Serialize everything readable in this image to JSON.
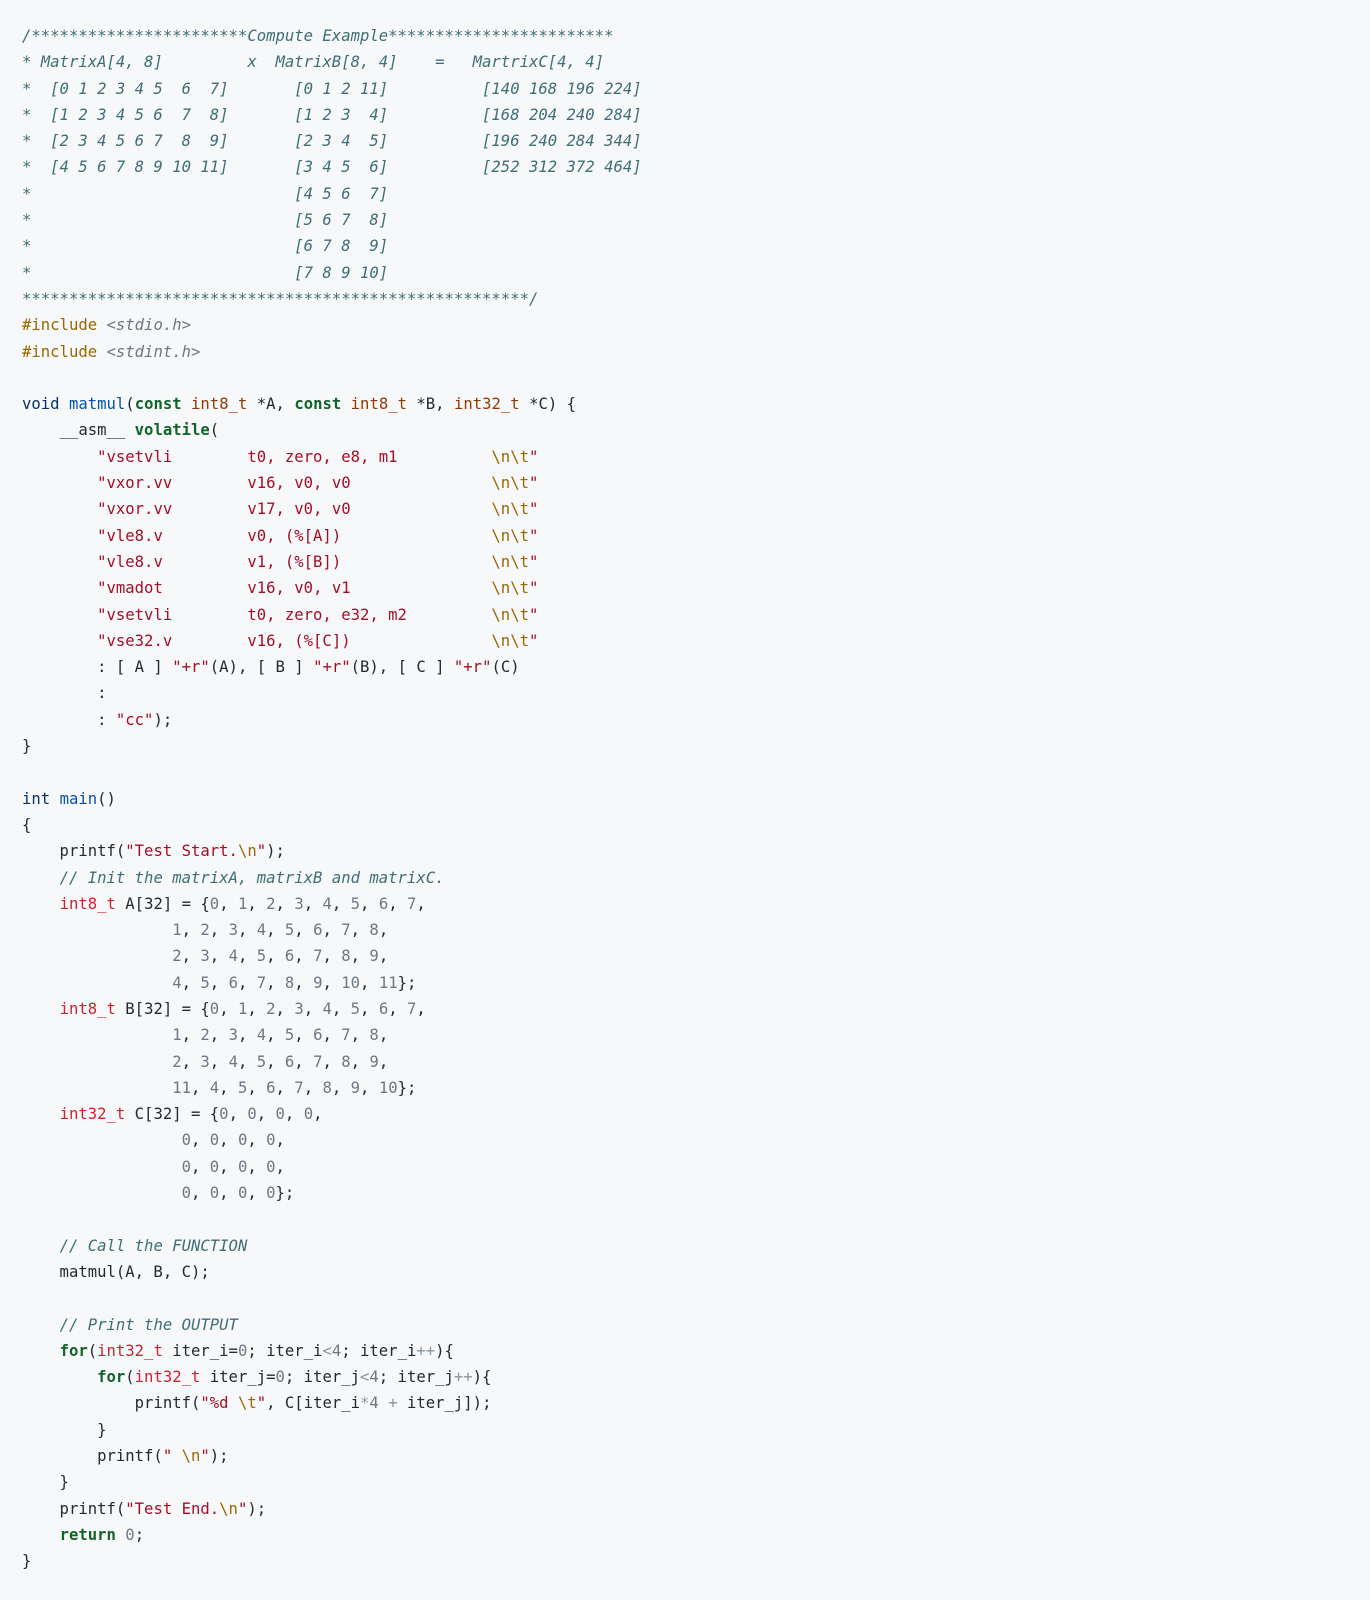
{
  "language": "c",
  "token_colors": {
    "cm": "#3f6e74",
    "pp": "#9a6700",
    "hdr": "#6e7781",
    "kw": "#0a3069",
    "kwb": "#116329",
    "ty": "#953800",
    "fn": "#8250df",
    "fnb": "#0550ae",
    "st": "#a40e26",
    "esc": "#9a6700",
    "nm": "#6e7781",
    "op": "#8c959f",
    "id": "#24292f",
    "vd": "#0a3069",
    "it": "#cf222e"
  },
  "lines": [
    [
      [
        "cm",
        "/***********************Compute Example************************"
      ]
    ],
    [
      [
        "cm",
        "* MatrixA[4, 8]         x  MatrixB[8, 4]    =   MartrixC[4, 4]"
      ]
    ],
    [
      [
        "cm",
        "*  [0 1 2 3 4 5  6  7]       [0 1 2 11]          [140 168 196 224]"
      ]
    ],
    [
      [
        "cm",
        "*  [1 2 3 4 5 6  7  8]       [1 2 3  4]          [168 204 240 284]"
      ]
    ],
    [
      [
        "cm",
        "*  [2 3 4 5 6 7  8  9]       [2 3 4  5]          [196 240 284 344]"
      ]
    ],
    [
      [
        "cm",
        "*  [4 5 6 7 8 9 10 11]       [3 4 5  6]          [252 312 372 464]"
      ]
    ],
    [
      [
        "cm",
        "*                            [4 5 6  7]"
      ]
    ],
    [
      [
        "cm",
        "*                            [5 6 7  8]"
      ]
    ],
    [
      [
        "cm",
        "*                            [6 7 8  9]"
      ]
    ],
    [
      [
        "cm",
        "*                            [7 8 9 10]"
      ]
    ],
    [
      [
        "cm",
        "******************************************************/"
      ]
    ],
    [
      [
        "pp",
        "#include"
      ],
      [
        "id",
        " "
      ],
      [
        "hdr",
        "<stdio.h>"
      ]
    ],
    [
      [
        "pp",
        "#include"
      ],
      [
        "id",
        " "
      ],
      [
        "hdr",
        "<stdint.h>"
      ]
    ],
    [],
    [
      [
        "vd",
        "void"
      ],
      [
        "id",
        " "
      ],
      [
        "fnb",
        "matmul"
      ],
      [
        "id",
        "("
      ],
      [
        "kwb",
        "const"
      ],
      [
        "id",
        " "
      ],
      [
        "ty",
        "int8_t"
      ],
      [
        "id",
        " *A, "
      ],
      [
        "kwb",
        "const"
      ],
      [
        "id",
        " "
      ],
      [
        "ty",
        "int8_t"
      ],
      [
        "id",
        " *B, "
      ],
      [
        "ty",
        "int32_t"
      ],
      [
        "id",
        " *C) {"
      ]
    ],
    [
      [
        "id",
        "    __asm__ "
      ],
      [
        "kwb",
        "volatile"
      ],
      [
        "id",
        "("
      ]
    ],
    [
      [
        "id",
        "        "
      ],
      [
        "st",
        "\"vsetvli        t0, zero, e8, m1          "
      ],
      [
        "esc",
        "\\n\\t"
      ],
      [
        "st",
        "\""
      ]
    ],
    [
      [
        "id",
        "        "
      ],
      [
        "st",
        "\"vxor.vv        v16, v0, v0               "
      ],
      [
        "esc",
        "\\n\\t"
      ],
      [
        "st",
        "\""
      ]
    ],
    [
      [
        "id",
        "        "
      ],
      [
        "st",
        "\"vxor.vv        v17, v0, v0               "
      ],
      [
        "esc",
        "\\n\\t"
      ],
      [
        "st",
        "\""
      ]
    ],
    [
      [
        "id",
        "        "
      ],
      [
        "st",
        "\"vle8.v         v0, (%[A])                "
      ],
      [
        "esc",
        "\\n\\t"
      ],
      [
        "st",
        "\""
      ]
    ],
    [
      [
        "id",
        "        "
      ],
      [
        "st",
        "\"vle8.v         v1, (%[B])                "
      ],
      [
        "esc",
        "\\n\\t"
      ],
      [
        "st",
        "\""
      ]
    ],
    [
      [
        "id",
        "        "
      ],
      [
        "st",
        "\"vmadot         v16, v0, v1               "
      ],
      [
        "esc",
        "\\n\\t"
      ],
      [
        "st",
        "\""
      ]
    ],
    [
      [
        "id",
        "        "
      ],
      [
        "st",
        "\"vsetvli        t0, zero, e32, m2         "
      ],
      [
        "esc",
        "\\n\\t"
      ],
      [
        "st",
        "\""
      ]
    ],
    [
      [
        "id",
        "        "
      ],
      [
        "st",
        "\"vse32.v        v16, (%[C])               "
      ],
      [
        "esc",
        "\\n\\t"
      ],
      [
        "st",
        "\""
      ]
    ],
    [
      [
        "id",
        "        : [ A ] "
      ],
      [
        "st",
        "\"+r\""
      ],
      [
        "id",
        "(A), [ B ] "
      ],
      [
        "st",
        "\"+r\""
      ],
      [
        "id",
        "(B), [ C ] "
      ],
      [
        "st",
        "\"+r\""
      ],
      [
        "id",
        "(C)"
      ]
    ],
    [
      [
        "id",
        "        :"
      ]
    ],
    [
      [
        "id",
        "        : "
      ],
      [
        "st",
        "\"cc\""
      ],
      [
        "id",
        ");"
      ]
    ],
    [
      [
        "id",
        "}"
      ]
    ],
    [],
    [
      [
        "vd",
        "int"
      ],
      [
        "id",
        " "
      ],
      [
        "fnb",
        "main"
      ],
      [
        "id",
        "()"
      ]
    ],
    [
      [
        "id",
        "{"
      ]
    ],
    [
      [
        "id",
        "    printf("
      ],
      [
        "st",
        "\"Test Start."
      ],
      [
        "esc",
        "\\n"
      ],
      [
        "st",
        "\""
      ],
      [
        "id",
        ");"
      ]
    ],
    [
      [
        "id",
        "    "
      ],
      [
        "cm",
        "// Init the matrixA, matrixB and matrixC."
      ]
    ],
    [
      [
        "id",
        "    "
      ],
      [
        "it",
        "int8_t"
      ],
      [
        "id",
        " A[32] = {"
      ],
      [
        "nm",
        "0"
      ],
      [
        "id",
        ", "
      ],
      [
        "nm",
        "1"
      ],
      [
        "id",
        ", "
      ],
      [
        "nm",
        "2"
      ],
      [
        "id",
        ", "
      ],
      [
        "nm",
        "3"
      ],
      [
        "id",
        ", "
      ],
      [
        "nm",
        "4"
      ],
      [
        "id",
        ", "
      ],
      [
        "nm",
        "5"
      ],
      [
        "id",
        ", "
      ],
      [
        "nm",
        "6"
      ],
      [
        "id",
        ", "
      ],
      [
        "nm",
        "7"
      ],
      [
        "id",
        ","
      ]
    ],
    [
      [
        "id",
        "                "
      ],
      [
        "nm",
        "1"
      ],
      [
        "id",
        ", "
      ],
      [
        "nm",
        "2"
      ],
      [
        "id",
        ", "
      ],
      [
        "nm",
        "3"
      ],
      [
        "id",
        ", "
      ],
      [
        "nm",
        "4"
      ],
      [
        "id",
        ", "
      ],
      [
        "nm",
        "5"
      ],
      [
        "id",
        ", "
      ],
      [
        "nm",
        "6"
      ],
      [
        "id",
        ", "
      ],
      [
        "nm",
        "7"
      ],
      [
        "id",
        ", "
      ],
      [
        "nm",
        "8"
      ],
      [
        "id",
        ","
      ]
    ],
    [
      [
        "id",
        "                "
      ],
      [
        "nm",
        "2"
      ],
      [
        "id",
        ", "
      ],
      [
        "nm",
        "3"
      ],
      [
        "id",
        ", "
      ],
      [
        "nm",
        "4"
      ],
      [
        "id",
        ", "
      ],
      [
        "nm",
        "5"
      ],
      [
        "id",
        ", "
      ],
      [
        "nm",
        "6"
      ],
      [
        "id",
        ", "
      ],
      [
        "nm",
        "7"
      ],
      [
        "id",
        ", "
      ],
      [
        "nm",
        "8"
      ],
      [
        "id",
        ", "
      ],
      [
        "nm",
        "9"
      ],
      [
        "id",
        ","
      ]
    ],
    [
      [
        "id",
        "                "
      ],
      [
        "nm",
        "4"
      ],
      [
        "id",
        ", "
      ],
      [
        "nm",
        "5"
      ],
      [
        "id",
        ", "
      ],
      [
        "nm",
        "6"
      ],
      [
        "id",
        ", "
      ],
      [
        "nm",
        "7"
      ],
      [
        "id",
        ", "
      ],
      [
        "nm",
        "8"
      ],
      [
        "id",
        ", "
      ],
      [
        "nm",
        "9"
      ],
      [
        "id",
        ", "
      ],
      [
        "nm",
        "10"
      ],
      [
        "id",
        ", "
      ],
      [
        "nm",
        "11"
      ],
      [
        "id",
        "};"
      ]
    ],
    [
      [
        "id",
        "    "
      ],
      [
        "it",
        "int8_t"
      ],
      [
        "id",
        " B[32] = {"
      ],
      [
        "nm",
        "0"
      ],
      [
        "id",
        ", "
      ],
      [
        "nm",
        "1"
      ],
      [
        "id",
        ", "
      ],
      [
        "nm",
        "2"
      ],
      [
        "id",
        ", "
      ],
      [
        "nm",
        "3"
      ],
      [
        "id",
        ", "
      ],
      [
        "nm",
        "4"
      ],
      [
        "id",
        ", "
      ],
      [
        "nm",
        "5"
      ],
      [
        "id",
        ", "
      ],
      [
        "nm",
        "6"
      ],
      [
        "id",
        ", "
      ],
      [
        "nm",
        "7"
      ],
      [
        "id",
        ","
      ]
    ],
    [
      [
        "id",
        "                "
      ],
      [
        "nm",
        "1"
      ],
      [
        "id",
        ", "
      ],
      [
        "nm",
        "2"
      ],
      [
        "id",
        ", "
      ],
      [
        "nm",
        "3"
      ],
      [
        "id",
        ", "
      ],
      [
        "nm",
        "4"
      ],
      [
        "id",
        ", "
      ],
      [
        "nm",
        "5"
      ],
      [
        "id",
        ", "
      ],
      [
        "nm",
        "6"
      ],
      [
        "id",
        ", "
      ],
      [
        "nm",
        "7"
      ],
      [
        "id",
        ", "
      ],
      [
        "nm",
        "8"
      ],
      [
        "id",
        ","
      ]
    ],
    [
      [
        "id",
        "                "
      ],
      [
        "nm",
        "2"
      ],
      [
        "id",
        ", "
      ],
      [
        "nm",
        "3"
      ],
      [
        "id",
        ", "
      ],
      [
        "nm",
        "4"
      ],
      [
        "id",
        ", "
      ],
      [
        "nm",
        "5"
      ],
      [
        "id",
        ", "
      ],
      [
        "nm",
        "6"
      ],
      [
        "id",
        ", "
      ],
      [
        "nm",
        "7"
      ],
      [
        "id",
        ", "
      ],
      [
        "nm",
        "8"
      ],
      [
        "id",
        ", "
      ],
      [
        "nm",
        "9"
      ],
      [
        "id",
        ","
      ]
    ],
    [
      [
        "id",
        "                "
      ],
      [
        "nm",
        "11"
      ],
      [
        "id",
        ", "
      ],
      [
        "nm",
        "4"
      ],
      [
        "id",
        ", "
      ],
      [
        "nm",
        "5"
      ],
      [
        "id",
        ", "
      ],
      [
        "nm",
        "6"
      ],
      [
        "id",
        ", "
      ],
      [
        "nm",
        "7"
      ],
      [
        "id",
        ", "
      ],
      [
        "nm",
        "8"
      ],
      [
        "id",
        ", "
      ],
      [
        "nm",
        "9"
      ],
      [
        "id",
        ", "
      ],
      [
        "nm",
        "10"
      ],
      [
        "id",
        "};"
      ]
    ],
    [
      [
        "id",
        "    "
      ],
      [
        "it",
        "int32_t"
      ],
      [
        "id",
        " C[32] = {"
      ],
      [
        "nm",
        "0"
      ],
      [
        "id",
        ", "
      ],
      [
        "nm",
        "0"
      ],
      [
        "id",
        ", "
      ],
      [
        "nm",
        "0"
      ],
      [
        "id",
        ", "
      ],
      [
        "nm",
        "0"
      ],
      [
        "id",
        ","
      ]
    ],
    [
      [
        "id",
        "                 "
      ],
      [
        "nm",
        "0"
      ],
      [
        "id",
        ", "
      ],
      [
        "nm",
        "0"
      ],
      [
        "id",
        ", "
      ],
      [
        "nm",
        "0"
      ],
      [
        "id",
        ", "
      ],
      [
        "nm",
        "0"
      ],
      [
        "id",
        ","
      ]
    ],
    [
      [
        "id",
        "                 "
      ],
      [
        "nm",
        "0"
      ],
      [
        "id",
        ", "
      ],
      [
        "nm",
        "0"
      ],
      [
        "id",
        ", "
      ],
      [
        "nm",
        "0"
      ],
      [
        "id",
        ", "
      ],
      [
        "nm",
        "0"
      ],
      [
        "id",
        ","
      ]
    ],
    [
      [
        "id",
        "                 "
      ],
      [
        "nm",
        "0"
      ],
      [
        "id",
        ", "
      ],
      [
        "nm",
        "0"
      ],
      [
        "id",
        ", "
      ],
      [
        "nm",
        "0"
      ],
      [
        "id",
        ", "
      ],
      [
        "nm",
        "0"
      ],
      [
        "id",
        "};"
      ]
    ],
    [],
    [
      [
        "id",
        "    "
      ],
      [
        "cm",
        "// Call the FUNCTION"
      ]
    ],
    [
      [
        "id",
        "    matmul(A, B, C);"
      ]
    ],
    [],
    [
      [
        "id",
        "    "
      ],
      [
        "cm",
        "// Print the OUTPUT"
      ]
    ],
    [
      [
        "id",
        "    "
      ],
      [
        "kwb",
        "for"
      ],
      [
        "id",
        "("
      ],
      [
        "it",
        "int32_t"
      ],
      [
        "id",
        " iter_i="
      ],
      [
        "nm",
        "0"
      ],
      [
        "id",
        "; iter_i"
      ],
      [
        "op",
        "<"
      ],
      [
        "nm",
        "4"
      ],
      [
        "id",
        "; iter_i"
      ],
      [
        "op",
        "++"
      ],
      [
        "id",
        "){"
      ]
    ],
    [
      [
        "id",
        "        "
      ],
      [
        "kwb",
        "for"
      ],
      [
        "id",
        "("
      ],
      [
        "it",
        "int32_t"
      ],
      [
        "id",
        " iter_j="
      ],
      [
        "nm",
        "0"
      ],
      [
        "id",
        "; iter_j"
      ],
      [
        "op",
        "<"
      ],
      [
        "nm",
        "4"
      ],
      [
        "id",
        "; iter_j"
      ],
      [
        "op",
        "++"
      ],
      [
        "id",
        "){"
      ]
    ],
    [
      [
        "id",
        "            printf("
      ],
      [
        "st",
        "\"%d "
      ],
      [
        "esc",
        "\\t"
      ],
      [
        "st",
        "\""
      ],
      [
        "id",
        ", C[iter_i"
      ],
      [
        "op",
        "*"
      ],
      [
        "nm",
        "4"
      ],
      [
        "id",
        " "
      ],
      [
        "op",
        "+"
      ],
      [
        "id",
        " iter_j]);"
      ]
    ],
    [
      [
        "id",
        "        }"
      ]
    ],
    [
      [
        "id",
        "        printf("
      ],
      [
        "st",
        "\" "
      ],
      [
        "esc",
        "\\n"
      ],
      [
        "st",
        "\""
      ],
      [
        "id",
        ");"
      ]
    ],
    [
      [
        "id",
        "    }"
      ]
    ],
    [
      [
        "id",
        "    printf("
      ],
      [
        "st",
        "\"Test End."
      ],
      [
        "esc",
        "\\n"
      ],
      [
        "st",
        "\""
      ],
      [
        "id",
        ");"
      ]
    ],
    [
      [
        "id",
        "    "
      ],
      [
        "kwb",
        "return"
      ],
      [
        "id",
        " "
      ],
      [
        "nm",
        "0"
      ],
      [
        "id",
        ";"
      ]
    ],
    [
      [
        "id",
        "}"
      ]
    ]
  ]
}
